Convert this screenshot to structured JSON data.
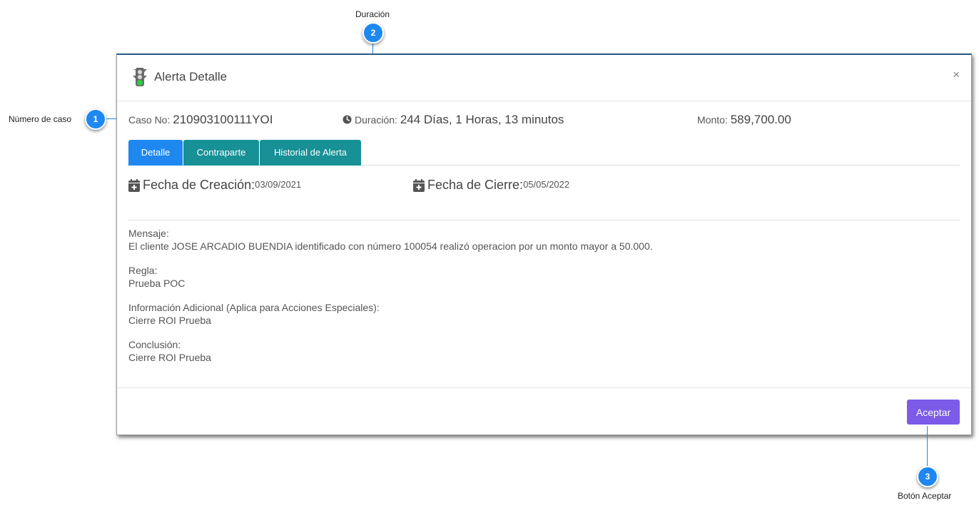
{
  "callouts": [
    {
      "number": "1",
      "label": "Número de caso"
    },
    {
      "number": "2",
      "label": "Duración"
    },
    {
      "number": "3",
      "label": "Botón Aceptar"
    }
  ],
  "modal": {
    "title": "Alerta Detalle",
    "close": "×",
    "case": {
      "label": "Caso No:",
      "value": "210903100111YOI"
    },
    "duration": {
      "label": "Duración:",
      "value": "244 Días, 1 Horas, 13 minutos"
    },
    "amount": {
      "label": "Monto:",
      "value": "589,700.00"
    },
    "tabs": [
      {
        "label": "Detalle",
        "active": true
      },
      {
        "label": "Contraparte"
      },
      {
        "label": "Historial de Alerta"
      }
    ],
    "dates": {
      "creation_label": "Fecha de Creación:",
      "creation_value": "03/09/2021",
      "close_label": "Fecha de Cierre:",
      "close_value": "05/05/2022"
    },
    "fields": [
      {
        "label": "Mensaje:",
        "value": "El cliente JOSE ARCADIO BUENDIA identificado con número 100054 realizó operacion por un monto mayor a 50.000."
      },
      {
        "label": "Regla:",
        "value": "Prueba POC"
      },
      {
        "label": "Información Adicional (Aplica para Acciones Especiales):",
        "value": "Cierre ROI Prueba"
      },
      {
        "label": "Conclusión:",
        "value": "Cierre ROI Prueba"
      }
    ],
    "accept_label": "Aceptar"
  },
  "colors": {
    "callout": "#1e88f0",
    "tab_active": "#1e88f0",
    "tab_inactive": "#179096",
    "accept": "#7b5be7",
    "traffic_light_on": "#2ecc40"
  },
  "icons": [
    "traffic-light-icon",
    "clock-icon",
    "calendar-plus-icon",
    "close-icon"
  ]
}
